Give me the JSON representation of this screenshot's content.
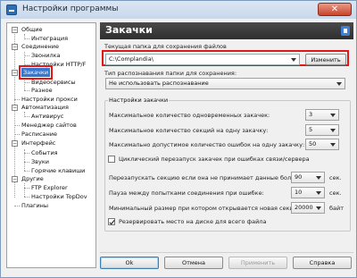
{
  "window": {
    "title": "Настройки программы",
    "close_glyph": "✕"
  },
  "tree": {
    "items": [
      {
        "label": "Общие"
      },
      {
        "label": "Интеграция"
      },
      {
        "label": "Соединение"
      },
      {
        "label": "Звонилка"
      },
      {
        "label": "Настройки HTTP/F"
      },
      {
        "label": "Закачки"
      },
      {
        "label": "Видеосервисы"
      },
      {
        "label": "Разное"
      },
      {
        "label": "Настройки прокси"
      },
      {
        "label": "Автоматизация"
      },
      {
        "label": "Антивирус"
      },
      {
        "label": "Менеджер сайтов"
      },
      {
        "label": "Расписание"
      },
      {
        "label": "Интерфейс"
      },
      {
        "label": "События"
      },
      {
        "label": "Звуки"
      },
      {
        "label": "Горячие клавиши"
      },
      {
        "label": "Другие"
      },
      {
        "label": "FTP Explorer"
      },
      {
        "label": "Настройки TopDov"
      },
      {
        "label": "Плагины"
      }
    ],
    "selected": "Закачки"
  },
  "page": {
    "title": "Закачки",
    "folder": {
      "label": "Текущая папка для сохранения файлов",
      "value": "C:\\Complandia\\",
      "change_button": "Изменить"
    },
    "recognition": {
      "label": "Тип распознавания папки для сохранения:",
      "value": "Не использовать распознавание"
    },
    "settings": {
      "title": "Настройки закачки",
      "max_simultaneous": {
        "label": "Максимальное количество одновременных закачек:",
        "value": "3"
      },
      "max_sections": {
        "label": "Максимальное количество секций на одну закачку:",
        "value": "5"
      },
      "max_errors": {
        "label": "Максимально допустимое количество ошибок на одну закачку:",
        "value": "50"
      },
      "cyclic_retry": {
        "label": "Циклический перезапуск закачек при ошибках связи/сервера",
        "checked": false
      },
      "restart_section": {
        "label": "Перезапускать секцию если она не принимает данные более:",
        "value": "90",
        "unit": "сек."
      },
      "pause_retry": {
        "label": "Пауза между попытками соединения при ошибке:",
        "value": "10",
        "unit": "сек."
      },
      "min_section": {
        "label": "Минимальный размер при котором открывается новая секция:",
        "value": "20000",
        "unit": "байт"
      },
      "reserve_disk": {
        "label": "Резервировать место на диске для всего файла",
        "checked": true
      }
    }
  },
  "footer": {
    "ok": "Ok",
    "cancel": "Отмена",
    "apply": "Применить",
    "help": "Справка"
  }
}
